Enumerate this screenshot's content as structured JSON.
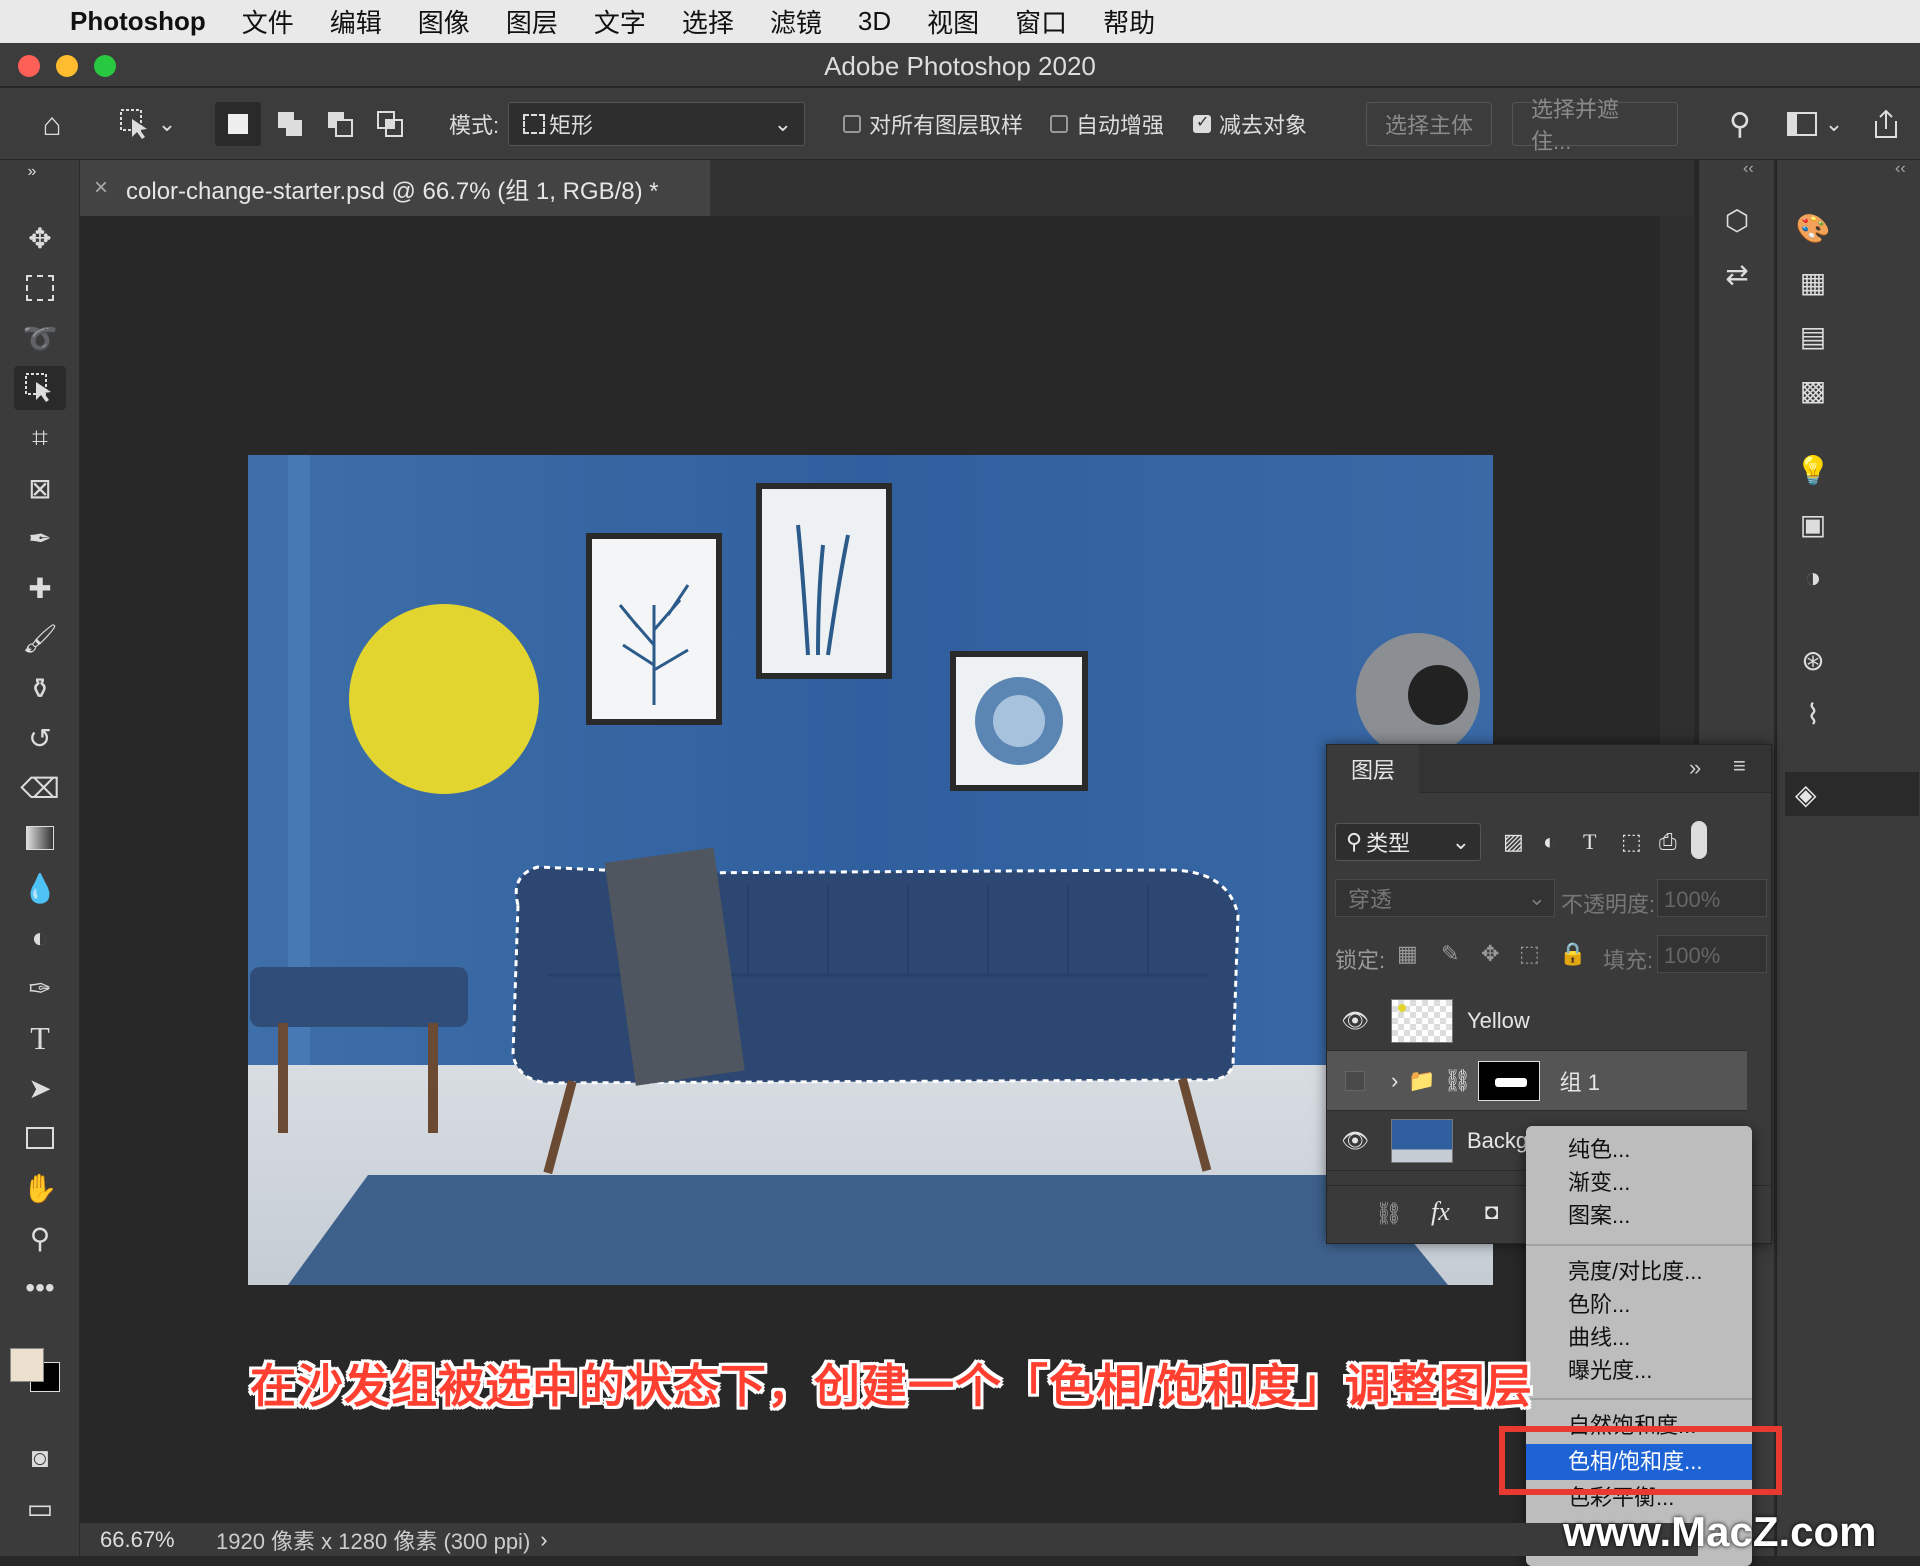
{
  "menubar": {
    "app": "Photoshop",
    "items": [
      "文件",
      "编辑",
      "图像",
      "图层",
      "文字",
      "选择",
      "滤镜",
      "3D",
      "视图",
      "窗口",
      "帮助"
    ]
  },
  "window": {
    "title": "Adobe Photoshop 2020"
  },
  "options": {
    "mode_label": "模式:",
    "mode_value": "矩形",
    "sample_all": "对所有图层取样",
    "auto_enhance": "自动增强",
    "subtract": "减去对象",
    "select_subject": "选择主体",
    "select_mask": "选择并遮住..."
  },
  "document": {
    "tab_title": "color-change-starter.psd @ 66.7% (组 1, RGB/8) *"
  },
  "layers_panel": {
    "title": "图层",
    "filter": "类型",
    "blend": "穿透",
    "opacity_label": "不透明度:",
    "opacity_value": "100%",
    "lock_label": "锁定:",
    "fill_label": "填充:",
    "fill_value": "100%",
    "layers": [
      {
        "name": "Yellow",
        "visible": true
      },
      {
        "name": "组 1",
        "visible": false
      },
      {
        "name": "Backg",
        "visible": true
      }
    ]
  },
  "context_menu": {
    "group1": [
      "纯色...",
      "渐变...",
      "图案..."
    ],
    "group2": [
      "亮度/对比度...",
      "色阶...",
      "曲线...",
      "曝光度..."
    ],
    "partial_above": "自然饱和度...",
    "highlighted": "色相/饱和度...",
    "partial_below": "色彩平衡..."
  },
  "status": {
    "zoom": "66.67%",
    "info": "1920 像素 x 1280 像素 (300 ppi)"
  },
  "caption": "在沙发组被选中的状态下，创建一个「色相/饱和度」调整图层",
  "watermark": "www.MacZ.com",
  "colors": {
    "accent": "#1d63d6",
    "highlight_box": "#e83a31",
    "caption_red": "#ff3f30"
  }
}
